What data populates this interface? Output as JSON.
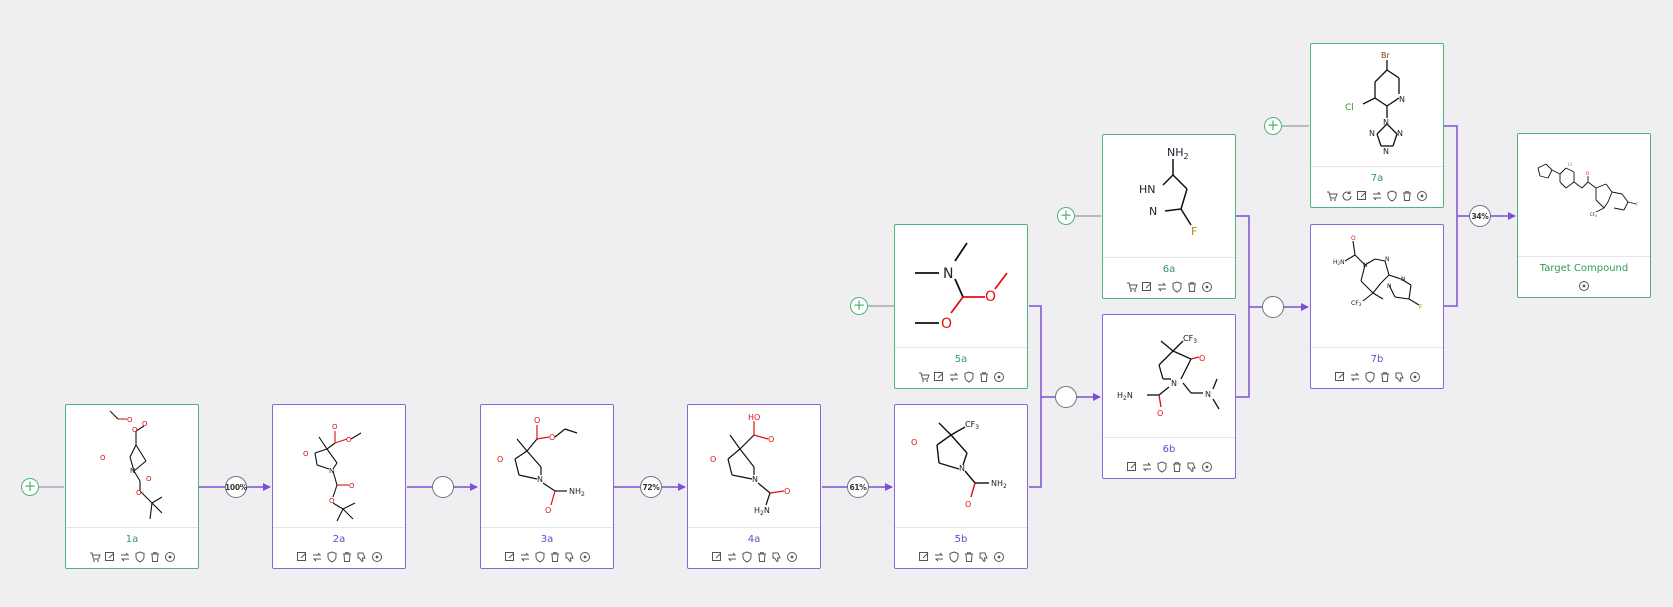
{
  "yields": {
    "y_1a_2a": "100%",
    "y_3a_4a": "72%",
    "y_4a_5b": "61%",
    "y_target": "34%"
  },
  "nodes": [
    {
      "id": "1a",
      "label": "1a",
      "kind": "starting-material",
      "actions": [
        "cart",
        "edit",
        "swap",
        "shield",
        "delete",
        "location"
      ]
    },
    {
      "id": "2a",
      "label": "2a",
      "kind": "intermediate",
      "actions": [
        "edit",
        "swap",
        "shield",
        "delete",
        "dislike",
        "location"
      ]
    },
    {
      "id": "3a",
      "label": "3a",
      "kind": "intermediate",
      "actions": [
        "edit",
        "swap",
        "shield",
        "delete",
        "dislike",
        "location"
      ]
    },
    {
      "id": "4a",
      "label": "4a",
      "kind": "intermediate",
      "actions": [
        "edit",
        "swap",
        "shield",
        "delete",
        "dislike",
        "location"
      ]
    },
    {
      "id": "5b",
      "label": "5b",
      "kind": "intermediate",
      "actions": [
        "edit",
        "swap",
        "shield",
        "delete",
        "dislike",
        "location"
      ]
    },
    {
      "id": "5a",
      "label": "5a",
      "kind": "starting-material",
      "actions": [
        "cart",
        "edit",
        "swap",
        "shield",
        "delete",
        "location"
      ]
    },
    {
      "id": "6b",
      "label": "6b",
      "kind": "intermediate",
      "actions": [
        "edit",
        "swap",
        "shield",
        "delete",
        "dislike",
        "location"
      ]
    },
    {
      "id": "6a",
      "label": "6a",
      "kind": "starting-material",
      "actions": [
        "cart",
        "edit",
        "swap",
        "shield",
        "delete",
        "location"
      ]
    },
    {
      "id": "7b",
      "label": "7b",
      "kind": "intermediate",
      "actions": [
        "edit",
        "swap",
        "shield",
        "delete",
        "dislike",
        "location"
      ]
    },
    {
      "id": "7a",
      "label": "7a",
      "kind": "starting-material",
      "actions": [
        "cart",
        "refresh",
        "edit",
        "swap",
        "shield",
        "delete",
        "location"
      ]
    },
    {
      "id": "target",
      "label": "Target Compound",
      "kind": "target",
      "actions": [
        "location"
      ]
    }
  ],
  "atoms": {
    "O": "O",
    "N": "N",
    "Cl": "Cl",
    "Br": "Br",
    "F": "F",
    "HO": "HO",
    "NH2": "NH",
    "sub2": "2",
    "H2N": "H",
    "H2Nsub": "2",
    "N_after": "N",
    "HN": "HN",
    "CF3": "CF",
    "sub3": "3",
    "NH2_6a": "NH",
    "sub2_6a": "2"
  },
  "colors": {
    "starting": "#4fb37a",
    "intermediate": "#8a66d6",
    "arrow": "#7c4fd8",
    "grayline": "#9a9aa6"
  }
}
